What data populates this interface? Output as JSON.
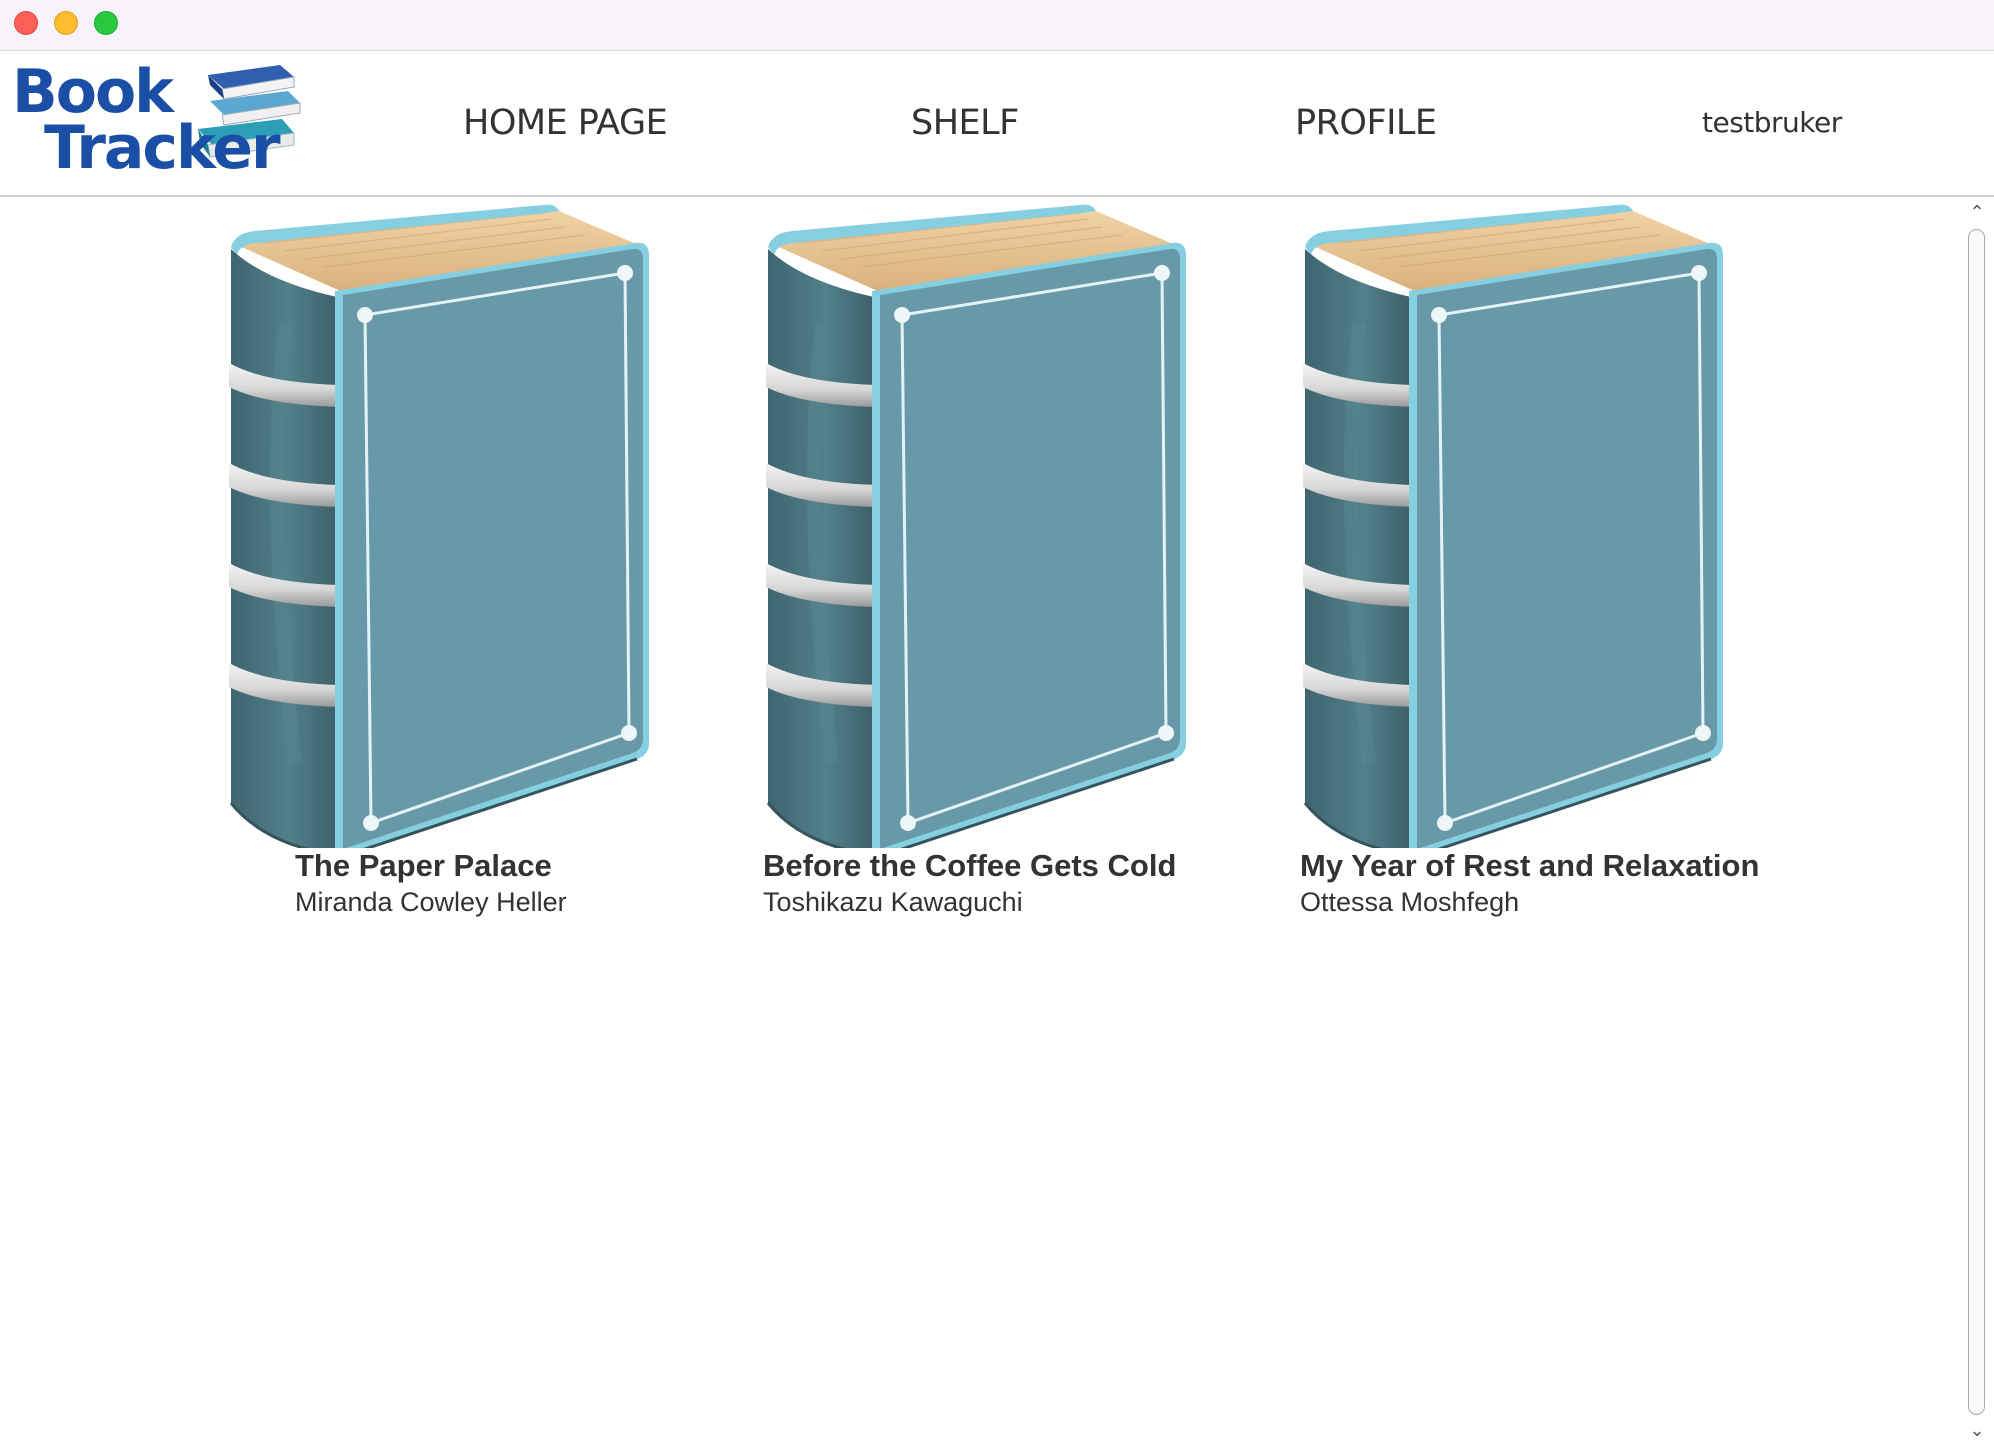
{
  "window": {
    "controls": [
      "close",
      "minimize",
      "maximize"
    ]
  },
  "header": {
    "logo": {
      "line1": "Book",
      "line2": "Tracker",
      "icon": "stacked-books-icon"
    },
    "nav": {
      "home": "HOME PAGE",
      "shelf": "SHELF",
      "profile": "PROFILE"
    },
    "username": "testbruker"
  },
  "books": [
    {
      "title": "The Paper Palace",
      "author": "Miranda Cowley Heller",
      "cover_icon": "book-cover-icon"
    },
    {
      "title": "Before the Coffee Gets Cold",
      "author": "Toshikazu Kawaguchi",
      "cover_icon": "book-cover-icon"
    },
    {
      "title": "My Year of Rest and Relaxation",
      "author": "Ottessa Moshfegh",
      "cover_icon": "book-cover-icon"
    }
  ],
  "colors": {
    "logo_text": "#1b4fa6",
    "cover_face": "#6899a8",
    "cover_spine": "#4a6e79",
    "cover_edge": "#86cfe0",
    "pages": "#e9c99b",
    "text": "#333333"
  }
}
